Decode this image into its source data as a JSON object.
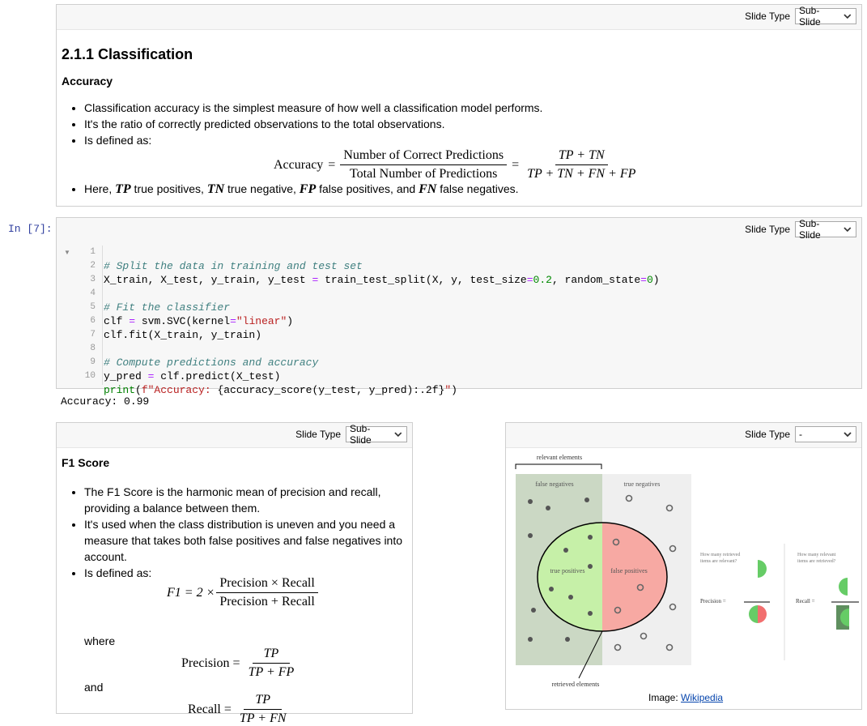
{
  "slide_type_label": "Slide Type",
  "cell1": {
    "slide_value": "Sub-Slide",
    "heading": "2.1.1 Classification",
    "subheading": "Accuracy",
    "bullets": [
      "Classification accuracy is the simplest measure of how well a classification model performs.",
      "It's the ratio of correctly predicted observations to the total observations.",
      "Is defined as:"
    ],
    "formula": {
      "lhs": "Accuracy",
      "num": "Number of Correct Predictions",
      "den": "Total Number of Predictions",
      "num2": "TP + TN",
      "den2": "TP + TN + FN + FP"
    },
    "last_bullet": {
      "t1": "Here, ",
      "tp": "TP",
      "t2": " true positives, ",
      "tn": "TN",
      "t3": " true negative, ",
      "fp": "FP",
      "t4": " false positives, and ",
      "fn": "FN",
      "t5": " false negatives."
    }
  },
  "cell2": {
    "prompt": "In [7]:",
    "slide_value": "Sub-Slide",
    "line_numbers": [
      "1",
      "2",
      "3",
      "4",
      "5",
      "6",
      "7",
      "8",
      "9",
      "10"
    ],
    "code": {
      "l1": "# Split the data in training and test set",
      "l2a": "X_train, X_test, y_train, y_test ",
      "l2b": "=",
      "l2c": " train_test_split(X, y, test_size",
      "l2d": "=",
      "l2e": "0.2",
      "l2f": ", random_state",
      "l2g": "=",
      "l2h": "0",
      "l2i": ")",
      "l4": "# Fit the classifier",
      "l5a": "clf ",
      "l5b": "=",
      "l5c": " svm.SVC(kernel",
      "l5d": "=",
      "l5e": "\"linear\"",
      "l5f": ")",
      "l6": "clf.fit(X_train, y_train)",
      "l8": "# Compute predictions and accuracy",
      "l9a": "y_pred ",
      "l9b": "=",
      "l9c": " clf.predict(X_test)",
      "l10a": "print",
      "l10b": "(",
      "l10c": "f\"Accuracy: ",
      "l10d": "{accuracy_score(y_test, y_pred):.2f}",
      "l10e": "\"",
      "l10f": ")"
    },
    "output": "Accuracy: 0.99"
  },
  "cell3": {
    "slide_value": "Sub-Slide",
    "heading": "F1 Score",
    "bullets": [
      "The F1 Score is the harmonic mean of precision and recall, providing a balance between them.",
      "It's used when the class distribution is uneven and you need a measure that takes both false positives and false negatives into account.",
      "Is defined as:"
    ],
    "f1": {
      "lhs": "F1 = 2 ×",
      "num": "Precision × Recall",
      "den": "Precision + Recall"
    },
    "where": "where",
    "precision": {
      "lhs": "Precision =",
      "num": "TP",
      "den": "TP + FP"
    },
    "and": "and",
    "recall": {
      "lhs": "Recall =",
      "num": "TP",
      "den": "TP + FN"
    }
  },
  "cell4": {
    "slide_value": "-",
    "diagram": {
      "relevant": "relevant elements",
      "false_negatives": "false negatives",
      "true_negatives": "true negatives",
      "true_positives": "true positives",
      "false_positives": "false positives",
      "retrieved": "retrieved elements",
      "q1a": "How many retrieved",
      "q1b": "items are relevant?",
      "q2a": "How many relevant",
      "q2b": "items are retrieved?",
      "precision": "Precision =",
      "recall": "Recall ="
    },
    "caption_prefix": "Image: ",
    "caption_link": "Wikipedia"
  }
}
